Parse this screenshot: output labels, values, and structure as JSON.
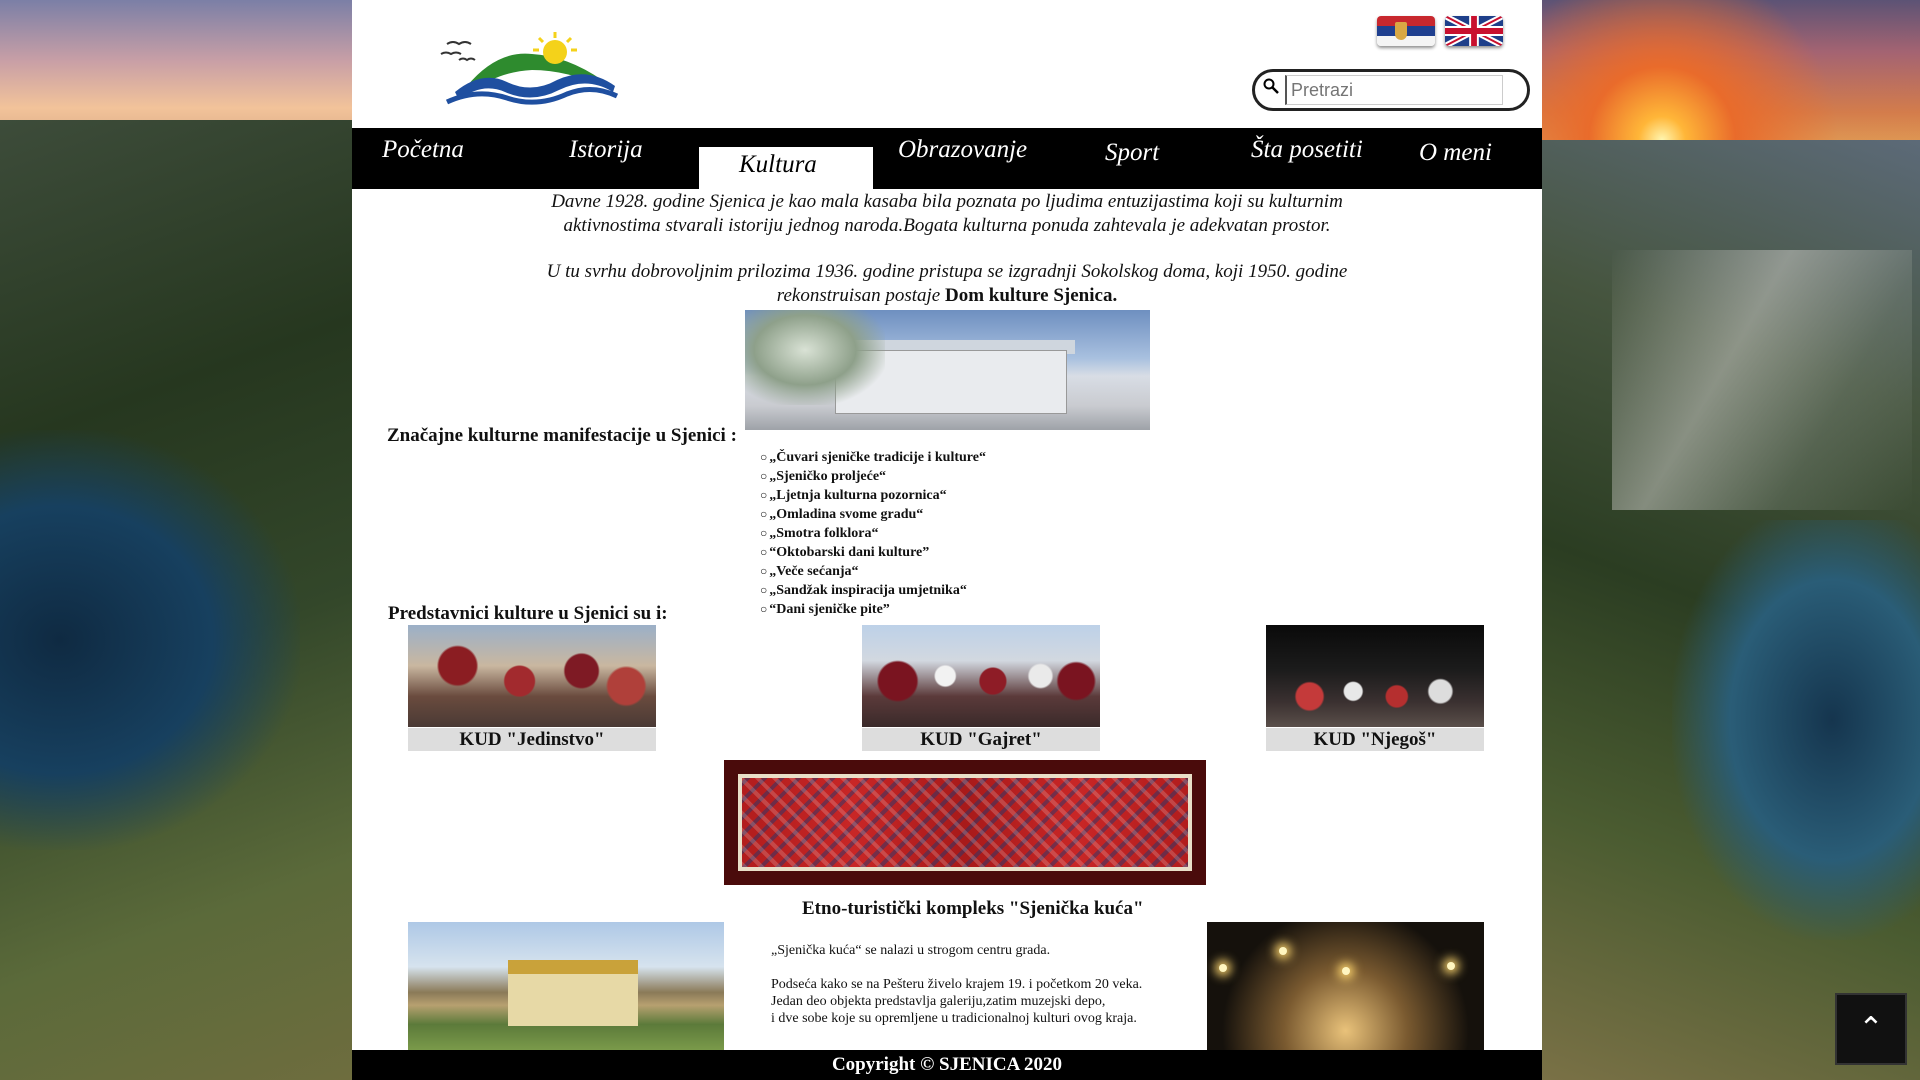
{
  "header": {
    "search_placeholder": "Pretrazi"
  },
  "nav": {
    "items": [
      "Početna",
      "Istorija",
      "Kultura",
      "Obrazovanje",
      "Sport",
      "Šta posetiti",
      "O meni"
    ],
    "active": "Kultura"
  },
  "intro": {
    "p1": "Davne 1928. godine Sjenica je kao mala kasaba bila poznata po ljudima entuzijastima koji su kulturnim aktivnostima stvarali istoriju jednog naroda.Bogata kulturna ponuda zahtevala je adekvatan prostor.",
    "p2_text": "U tu svrhu dobrovoljnim prilozima 1936. godine pristupa se izgradnji Sokolskog doma, koji 1950. godine rekonstruisan postaje",
    "p2_bold": "Dom kulture Sjenica."
  },
  "manifestations": {
    "title": "Značajne kulturne manifestacije u Sjenici :",
    "items": [
      "„Čuvari sjeničke tradicije i kulture“",
      "„Sjeničko proljeće“",
      "„Ljetnja kulturna pozornica“",
      "„Omladina svome gradu“",
      "„Smotra folklora“",
      "“Oktobarski dani kulture”",
      "„Veče sećanja“",
      "„Sandžak inspiracija umjetnika“",
      "“Dani sjeničke pite”"
    ]
  },
  "representatives": {
    "title": "Predstavnici kulture u Sjenici su i:",
    "kud": [
      "KUD \"Jedinstvo\"",
      "KUD \"Gajret\"",
      "KUD \"Njegoš\""
    ]
  },
  "etno": {
    "title": "Etno-turistički kompleks \"Sjenička kuća\"",
    "line1": "„Sjenička kuća“ se nalazi u strogom centru grada.",
    "line2": "Podseća kako se na Pešteru živelo krajem 19. i početkom 20 veka.",
    "line3": "Jedan deo objekta predstavlja galeriju,zatim muzejski depo,",
    "line4": "i dve sobe koje su opremljene u tradicionalnoj kulturi ovog kraja."
  },
  "footer": {
    "copyright": "Copyright © SJENICA 2020"
  },
  "icons": {
    "to_top": "chevron-up-icon",
    "search": "search-icon"
  },
  "colors": {
    "nav_bg": "#000000",
    "page_bg": "#ffffff",
    "caption_bg": "#dddddd"
  }
}
